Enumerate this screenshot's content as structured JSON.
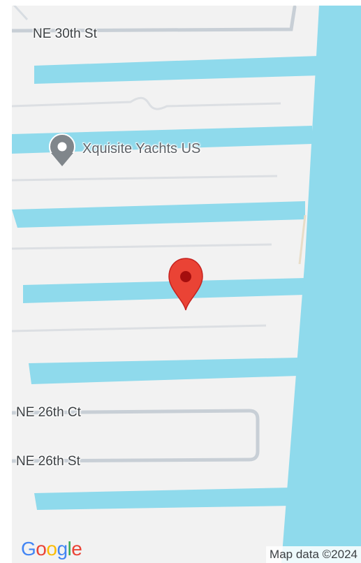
{
  "map": {
    "streets": {
      "ne_30th_st": "NE 30th St",
      "ne_26th_ct": "NE 26th Ct",
      "ne_26th_st": "NE 26th St"
    },
    "poi": {
      "name": "Xquisite Yachts US",
      "icon": "place-pin-icon"
    },
    "marker": {
      "icon": "red-location-marker-icon",
      "color": "#ea4335"
    },
    "water_color": "#8fdaec",
    "land_color": "#f2f2f2"
  },
  "branding": {
    "logo_letters": [
      "G",
      "o",
      "o",
      "g",
      "l",
      "e"
    ],
    "logo_colors": [
      "#4285f4",
      "#ea4335",
      "#fbbc05",
      "#4285f4",
      "#34a853",
      "#ea4335"
    ],
    "attribution": "Map data ©2024"
  }
}
